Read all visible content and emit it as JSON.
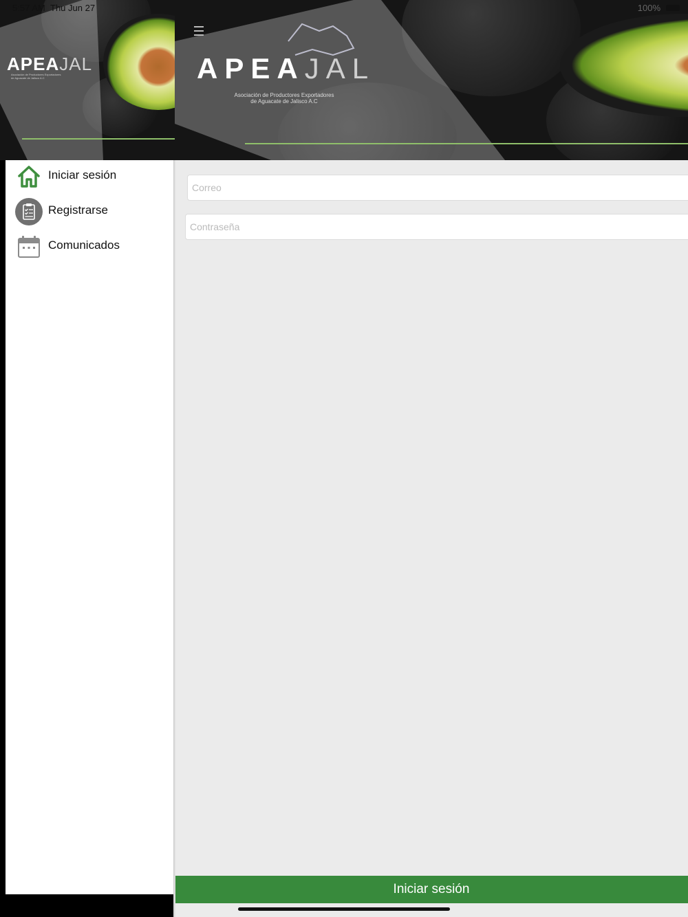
{
  "status_bar": {
    "time": "5:57 AM",
    "date": "Thu Jun 27",
    "battery": "100%"
  },
  "brand": {
    "name_part1": "APEA",
    "name_part2": "JAL",
    "subtitle_line1": "Asociación de Productores Exportadores",
    "subtitle_line2": "de Aguacate de Jalisco A.C"
  },
  "drawer": {
    "items": [
      {
        "label": "Iniciar sesión",
        "icon": "home-icon"
      },
      {
        "label": "Registrarse",
        "icon": "clipboard-icon"
      },
      {
        "label": "Comunicados",
        "icon": "calendar-icon"
      }
    ]
  },
  "login_form": {
    "email_placeholder": "Correo",
    "password_placeholder": "Contraseña",
    "submit_label": "Iniciar sesión"
  },
  "colors": {
    "accent_green": "#388a3c",
    "header_line": "#8fbf6a",
    "home_icon": "#3f8f3f"
  }
}
